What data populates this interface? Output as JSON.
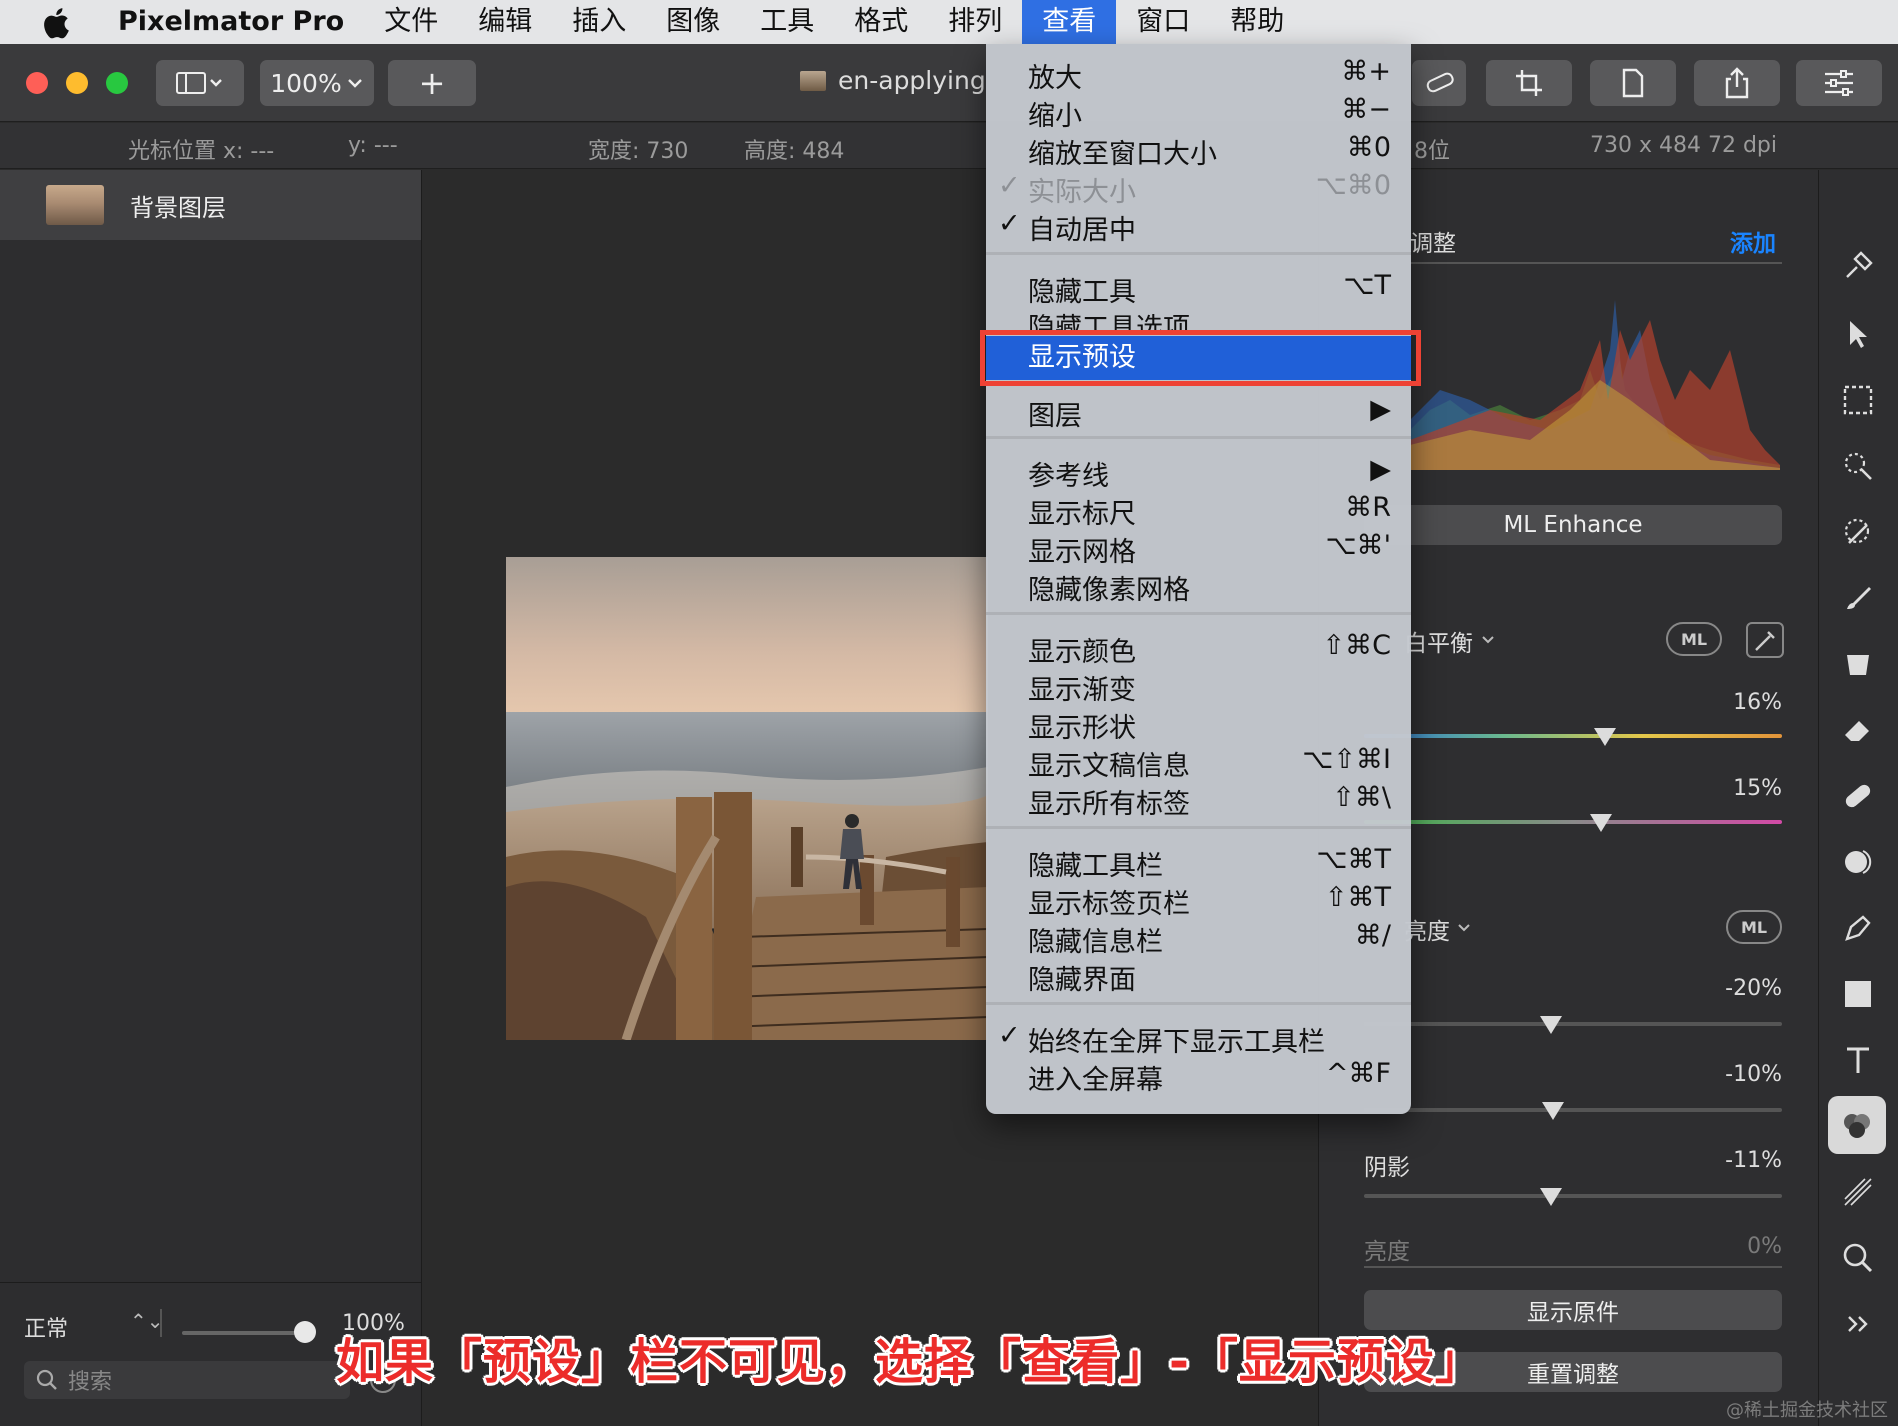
{
  "menubar": {
    "app_name": "Pixelmator Pro",
    "items": [
      "文件",
      "编辑",
      "插入",
      "图像",
      "工具",
      "格式",
      "排列",
      "查看",
      "窗口",
      "帮助"
    ],
    "active_item": "查看"
  },
  "toolbar": {
    "zoom": "100%",
    "add": "+",
    "document_title": "en-applying"
  },
  "infobar": {
    "cursor_x": "光标位置 x: ---",
    "cursor_y": "y: ---",
    "width": "宽度: 730",
    "height": "高度: 484",
    "bit_depth": "8位",
    "size_dpi": "730 x 484 72 dpi"
  },
  "layers": {
    "items": [
      {
        "name": "背景图层"
      }
    ],
    "blend_mode": "正常",
    "opacity": "100%",
    "search_placeholder": "搜索"
  },
  "view_menu": {
    "items": [
      {
        "label": "放大",
        "shortcut": "⌘+",
        "checked": false
      },
      {
        "label": "缩小",
        "shortcut": "⌘−",
        "checked": false
      },
      {
        "label": "缩放至窗口大小",
        "shortcut": "⌘0",
        "checked": false
      },
      {
        "label": "实际大小",
        "shortcut": "⌥⌘0",
        "checked": true,
        "disabled": true
      },
      {
        "label": "自动居中",
        "shortcut": "",
        "checked": true
      },
      {
        "label": "隐藏工具",
        "shortcut": "⌥T"
      },
      {
        "label": "隐藏工具选项",
        "shortcut": ""
      },
      {
        "label": "显示预设",
        "shortcut": "",
        "highlighted": true
      },
      {
        "label": "图层",
        "shortcut": "▶"
      },
      {
        "label": "参考线",
        "shortcut": "▶"
      },
      {
        "label": "显示标尺",
        "shortcut": "⌘R"
      },
      {
        "label": "显示网格",
        "shortcut": "⌥⌘'"
      },
      {
        "label": "隐藏像素网格",
        "shortcut": ""
      },
      {
        "label": "显示颜色",
        "shortcut": "⇧⌘C"
      },
      {
        "label": "显示渐变",
        "shortcut": ""
      },
      {
        "label": "显示形状",
        "shortcut": ""
      },
      {
        "label": "显示文稿信息",
        "shortcut": "⌥⇧⌘I"
      },
      {
        "label": "显示所有标签",
        "shortcut": "⇧⌘\\"
      },
      {
        "label": "隐藏工具栏",
        "shortcut": "⌥⌘T"
      },
      {
        "label": "显示标签页栏",
        "shortcut": "⇧⌘T"
      },
      {
        "label": "隐藏信息栏",
        "shortcut": "⌘/"
      },
      {
        "label": "隐藏界面",
        "shortcut": ""
      },
      {
        "label": "始终在全屏下显示工具栏",
        "shortcut": "",
        "checked": true
      },
      {
        "label": "进入全屏幕",
        "shortcut": "^⌘F"
      }
    ]
  },
  "adjust_panel": {
    "title": "调整",
    "add_label": "添加",
    "ml_enhance": "ML Enhance",
    "white_balance": "白平衡",
    "ml_badge": "ML",
    "wb_value_1": "16%",
    "wb_value_2": "15%",
    "light_section": "亮度",
    "light_value_1": "-20%",
    "light_value_2": "-10%",
    "shadows_label": "阴影",
    "shadows_value": "-11%",
    "brightness_label": "亮度",
    "brightness_value": "0%",
    "show_original": "显示原件",
    "reset": "重置调整"
  },
  "caption": "如果「预设」栏不可见，选择「查看」-「显示预设」",
  "watermark": "@稀土掘金技术社区",
  "colors": {
    "menu_highlight": "#2060d8",
    "annotation_red": "#ee4234",
    "accent_blue": "#1a84ff"
  }
}
